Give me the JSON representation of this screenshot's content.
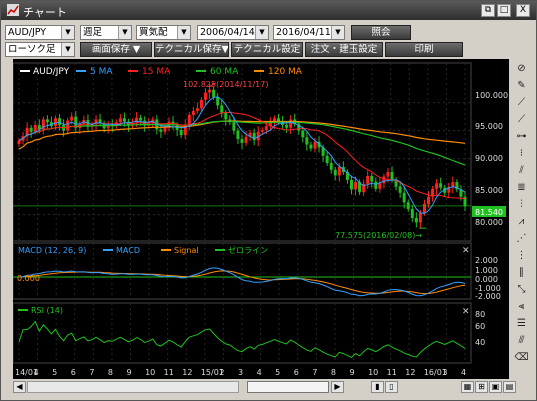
{
  "window": {
    "title": "チャート",
    "controls": [
      "_",
      "□",
      "X"
    ],
    "restore_label": "⧉"
  },
  "toolbar": {
    "symbol": "AUD/JPY",
    "period": "週足",
    "price_type": "買気配",
    "start_date": "2006/04/14",
    "end_date": "2016/04/11",
    "show_button": "照会",
    "candle_type": "ローソク足",
    "save_screen": "画面保存 ▼",
    "tech_save": "テクニカル保存▼",
    "tech_settings": "テクニカル設定",
    "order_settings": "注文・建玉設定",
    "print": "印刷"
  },
  "main_legend": {
    "symbol": "AUD/JPY",
    "ma5": "5 MA",
    "ma15": "15 MA",
    "ma60": "60 MA",
    "ma120": "120 MA"
  },
  "price_axis": [
    "100.000",
    "95.000",
    "90.000",
    "85.000",
    "80.000"
  ],
  "current_price": "81.540",
  "annotations": {
    "high": "102.825(2014/11/17)",
    "low": "77.575(2016/02/08)→"
  },
  "macd": {
    "legend_title": "MACD (12, 26, 9)",
    "macd_label": "MACD",
    "signal_label": "Signal",
    "zero_label": "ゼロライン",
    "zero_value": "0.000",
    "axis": [
      "2.000",
      "1.000",
      "0.000",
      "-1.000",
      "-2.000"
    ]
  },
  "rsi": {
    "legend_title": "RSI (14)",
    "axis": [
      "80",
      "60",
      "40"
    ]
  },
  "date_axis": [
    "14/01",
    "4",
    "5",
    "6",
    "7",
    "8",
    "9",
    "10",
    "11",
    "12",
    "15/01",
    "2",
    "3",
    "4",
    "5",
    "6",
    "7",
    "8",
    "9",
    "10",
    "11",
    "12",
    "16/01",
    "3",
    "4"
  ],
  "close_symbol": "✕",
  "colors": {
    "ma5": "#33a0ff",
    "ma15": "#ff2020",
    "ma60": "#20c020",
    "ma120": "#ff8c00",
    "candle_up": "#ff2020",
    "candle_down": "#20c020",
    "macd": "#33a0ff",
    "signal": "#ff8c00",
    "zero": "#20c020",
    "rsi": "#20c020"
  },
  "chart_data": {
    "type": "candlestick",
    "title": "",
    "ylim": [
      76,
      106
    ],
    "closes": [
      93.2,
      94.0,
      95.5,
      94.8,
      96.0,
      95.2,
      97.0,
      96.5,
      95.8,
      97.2,
      96.0,
      95.0,
      96.8,
      97.5,
      95.5,
      96.2,
      96.9,
      95.7,
      96.1,
      97.0,
      96.3,
      95.4,
      96.0,
      95.8,
      96.5,
      97.2,
      96.6,
      95.9,
      96.4,
      97.3,
      96.8,
      95.9,
      96.3,
      97.0,
      95.2,
      94.8,
      95.6,
      96.6,
      96.0,
      95.1,
      94.2,
      96.0,
      97.8,
      98.5,
      99.0,
      100.5,
      101.8,
      102.3,
      101.0,
      99.5,
      98.2,
      97.0,
      96.5,
      95.0,
      93.5,
      92.8,
      93.9,
      94.6,
      93.3,
      94.8,
      95.1,
      95.8,
      96.4,
      97.2,
      96.6,
      96.0,
      95.5,
      97.0,
      96.2,
      95.0,
      93.8,
      92.5,
      91.8,
      93.0,
      92.0,
      90.5,
      89.2,
      88.0,
      87.0,
      88.5,
      87.6,
      86.2,
      84.5,
      85.8,
      84.0,
      85.5,
      86.9,
      85.9,
      84.6,
      85.6,
      86.8,
      87.6,
      86.2,
      85.0,
      83.9,
      82.2,
      81.0,
      79.4,
      78.6,
      80.3,
      81.9,
      83.2,
      84.6,
      85.6,
      84.8,
      83.9,
      84.9,
      85.8,
      84.5,
      83.2,
      81.5
    ],
    "ma_series": [
      "5 MA",
      "15 MA",
      "60 MA",
      "120 MA"
    ],
    "high_marker": 102.825,
    "low_marker": 77.575,
    "current": 81.54,
    "macd_ylim": [
      -3,
      3
    ],
    "rsi_ylim": [
      20,
      90
    ]
  }
}
